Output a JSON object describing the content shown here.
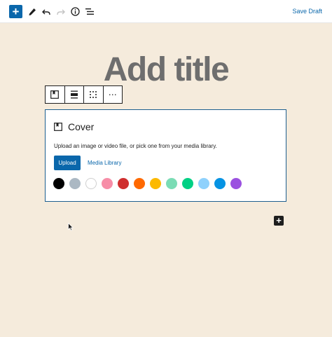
{
  "header": {
    "add_label": "+",
    "save_draft_label": "Save Draft",
    "icons": [
      "plus-icon",
      "pencil-icon",
      "undo-icon",
      "redo-icon",
      "info-icon",
      "list-view-icon"
    ]
  },
  "editor": {
    "title_placeholder": "Add title"
  },
  "block_toolbar": {
    "icons": [
      "cover-block-icon",
      "align-icon",
      "drag-handle-icon",
      "more-options-icon"
    ],
    "more_label": "⋯"
  },
  "cover": {
    "label": "Cover",
    "instructions": "Upload an image or video file, or pick one from your media library.",
    "upload_label": "Upload",
    "media_library_label": "Media Library",
    "colors": [
      "#000000",
      "#abb8c3",
      "#ffffff",
      "#f78da7",
      "#cf2e2e",
      "#ff6900",
      "#fcb900",
      "#7bdcb5",
      "#00d084",
      "#8ed1fc",
      "#0693e3",
      "#9b51e0"
    ]
  },
  "inserter": {
    "label": "+"
  }
}
